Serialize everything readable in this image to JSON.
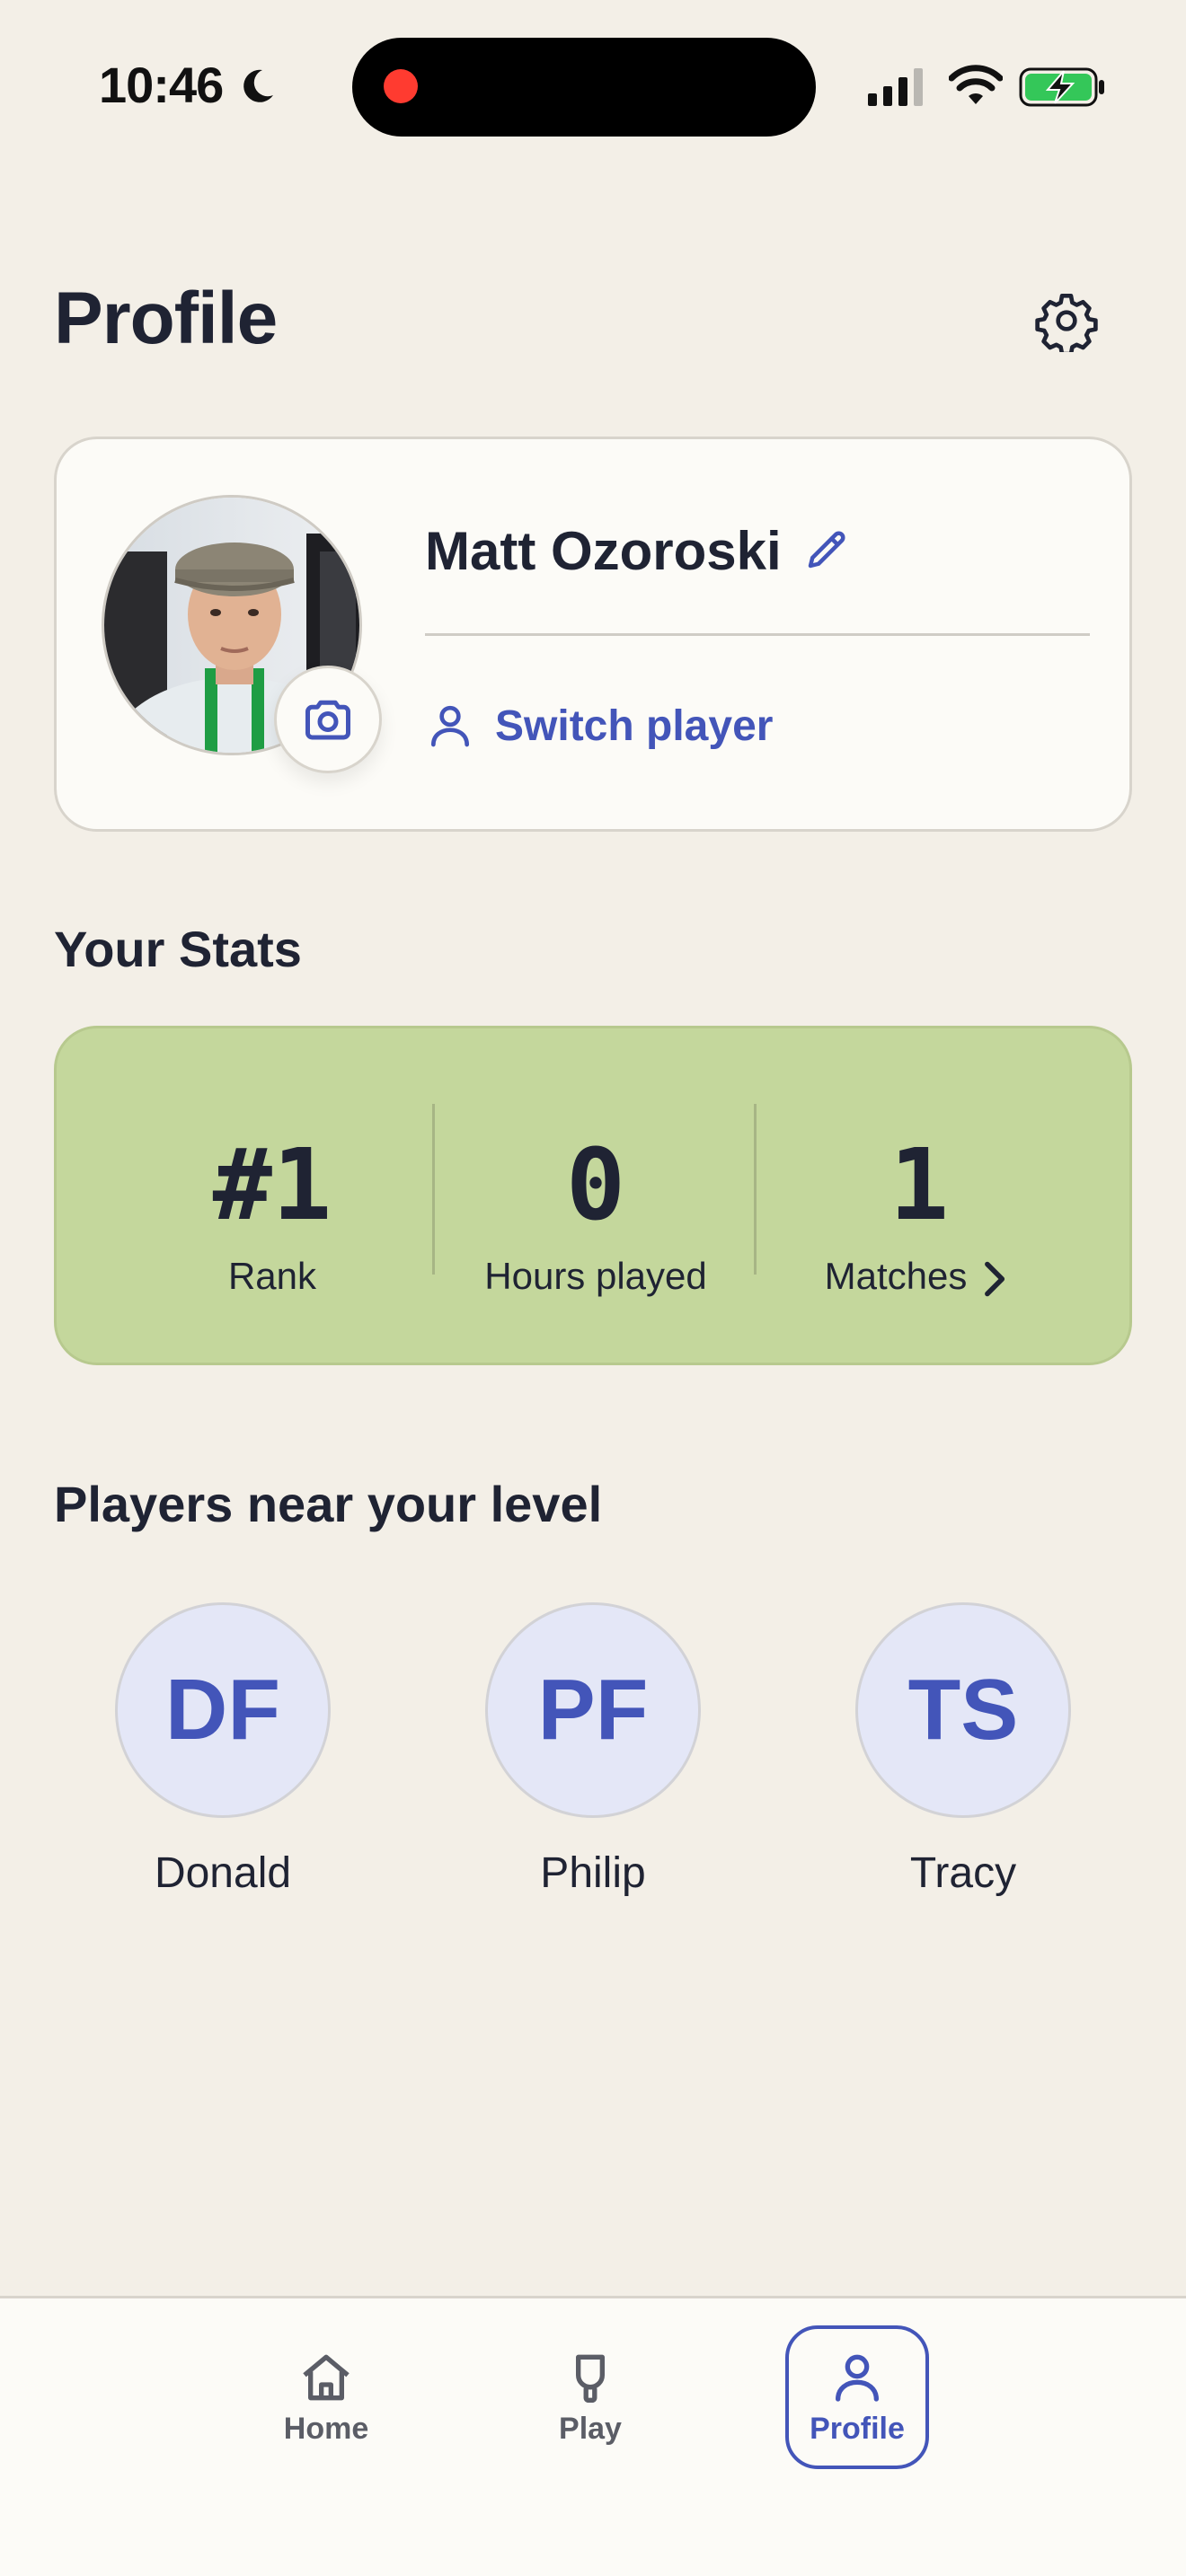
{
  "status_bar": {
    "time": "10:46",
    "icons": [
      "moon-icon",
      "cellular-signal-icon",
      "wifi-icon",
      "battery-charging-icon"
    ],
    "recording_indicator_color": "#ff3b30"
  },
  "header": {
    "title": "Profile",
    "settings_icon": "gear-icon"
  },
  "profile_card": {
    "name": "Matt Ozoroski",
    "edit_icon": "pencil-icon",
    "camera_icon": "camera-icon",
    "switch_player_label": "Switch player",
    "switch_player_icon": "person-icon"
  },
  "stats": {
    "section_title": "Your Stats",
    "items": [
      {
        "value": "#1",
        "label": "Rank"
      },
      {
        "value": "0",
        "label": "Hours played"
      },
      {
        "value": "1",
        "label": "Matches"
      }
    ],
    "background_color": "#c4d79c"
  },
  "players_near": {
    "section_title": "Players near your level",
    "players": [
      {
        "initials": "DF",
        "name": "Donald"
      },
      {
        "initials": "PF",
        "name": "Philip"
      },
      {
        "initials": "TS",
        "name": "Tracy"
      }
    ]
  },
  "tab_bar": {
    "tabs": [
      {
        "label": "Home",
        "icon": "home-icon",
        "active": false
      },
      {
        "label": "Play",
        "icon": "paddle-icon",
        "active": false
      },
      {
        "label": "Profile",
        "icon": "person-icon",
        "active": true
      }
    ]
  },
  "colors": {
    "accent": "#4355b9",
    "background": "#f3efe7",
    "card": "#fcfbf7",
    "text": "#1f2333"
  }
}
